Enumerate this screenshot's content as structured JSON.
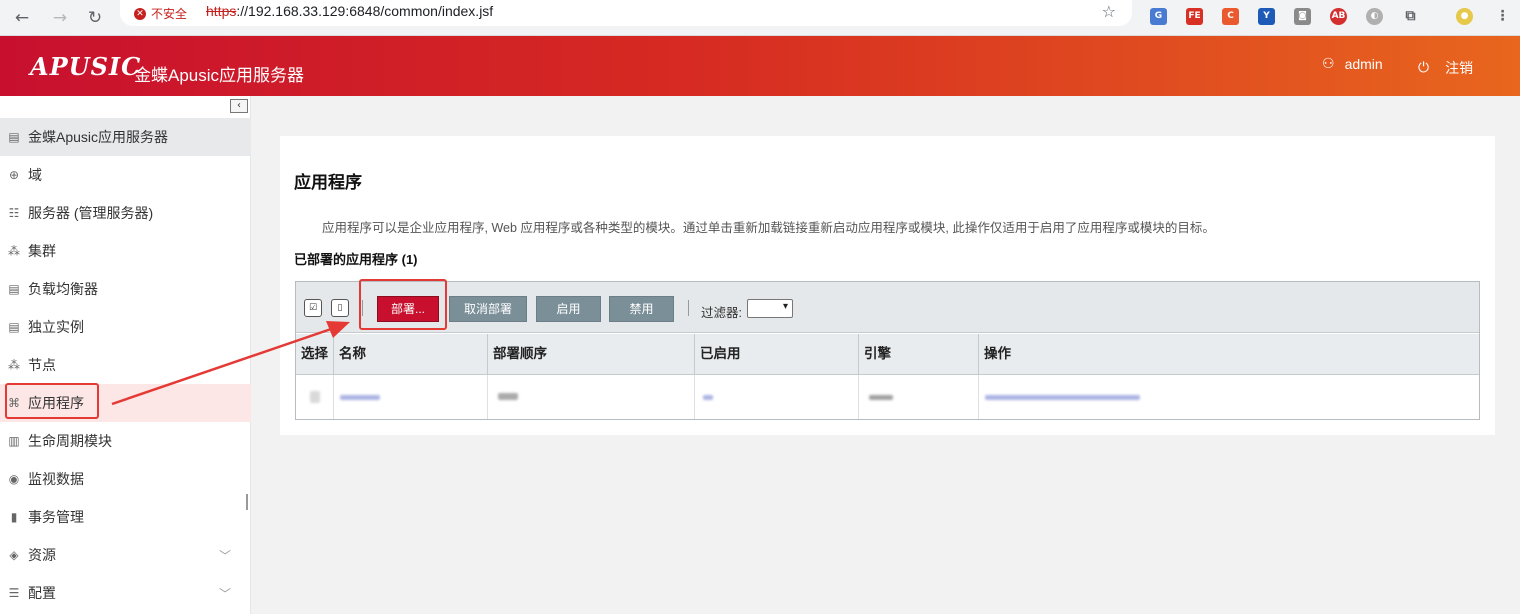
{
  "browser": {
    "security_label": "不安全",
    "url_protocol": "https",
    "url_rest": "://192.168.33.129:6848/common/index.jsf"
  },
  "header": {
    "logo_text": "APUSIC",
    "title": "金蝶Apusic应用服务器",
    "user": "admin",
    "logout": "注销"
  },
  "sidebar": {
    "items": [
      {
        "label": "金蝶Apusic应用服务器",
        "icon": "server-root-icon"
      },
      {
        "label": "域",
        "icon": "globe-icon"
      },
      {
        "label": "服务器 (管理服务器)",
        "icon": "server-icon"
      },
      {
        "label": "集群",
        "icon": "cluster-icon"
      },
      {
        "label": "负载均衡器",
        "icon": "load-balancer-icon"
      },
      {
        "label": "独立实例",
        "icon": "instance-icon"
      },
      {
        "label": "节点",
        "icon": "node-icon"
      },
      {
        "label": "应用程序",
        "icon": "applications-icon"
      },
      {
        "label": "生命周期模块",
        "icon": "lifecycle-icon"
      },
      {
        "label": "监视数据",
        "icon": "monitor-icon"
      },
      {
        "label": "事务管理",
        "icon": "transaction-icon"
      },
      {
        "label": "资源",
        "icon": "resources-icon"
      },
      {
        "label": "配置",
        "icon": "config-icon"
      }
    ]
  },
  "main": {
    "title": "应用程序",
    "description": "应用程序可以是企业应用程序, Web 应用程序或各种类型的模块。通过单击重新加载链接重新启动应用程序或模块, 此操作仅适用于启用了应用程序或模块的目标。",
    "section_title": "已部署的应用程序 (1)",
    "toolbar": {
      "deploy": "部署...",
      "undeploy": "取消部署",
      "enable": "启用",
      "disable": "禁用",
      "filter_label": "过滤器:"
    },
    "columns": [
      "选择",
      "名称",
      "部署顺序",
      "已启用",
      "引擎",
      "操作"
    ]
  },
  "colors": {
    "brand_red": "#c8102e",
    "brand_orange": "#e8661e",
    "annotation_red": "#e53935"
  }
}
